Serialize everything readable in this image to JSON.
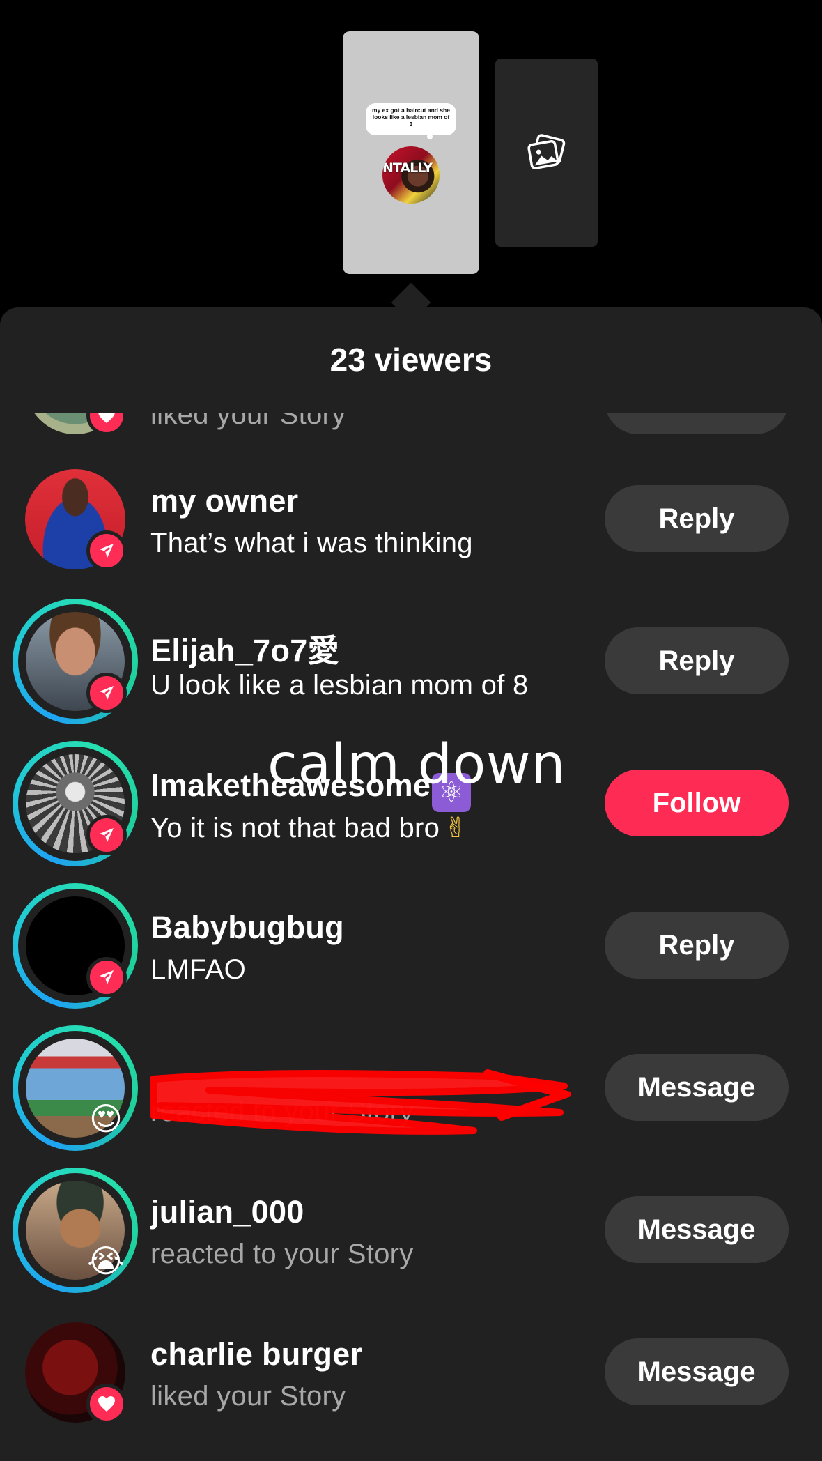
{
  "story_preview": {
    "caption": "my ex got a haircut and she looks like a lesbian mom of 3",
    "thumb_overlay": "NTALLY"
  },
  "sheet": {
    "title": "23 viewers"
  },
  "overlay_caption": "calm down",
  "viewers": [
    {
      "name": "",
      "activity": "liked your Story",
      "badge": "heart-icon",
      "action": ""
    },
    {
      "name": "my owner",
      "activity": "That’s what i was thinking",
      "badge": "send-icon",
      "action": "Reply"
    },
    {
      "name": "Elijah_7o7愛",
      "activity": "U look like a lesbian mom of 8",
      "badge": "send-icon",
      "action": "Reply"
    },
    {
      "name": "Imaketheawesome",
      "name_suffix": "⚛",
      "activity": "Yo it is not that bad bro",
      "activity_suffix": "✌",
      "badge": "send-icon",
      "action": "Follow"
    },
    {
      "name": "Babybugbug",
      "activity": "LMFAO",
      "badge": "send-icon",
      "action": "Reply"
    },
    {
      "name": "",
      "activity": "reacted to your Story",
      "badge": "😍",
      "action": "Message"
    },
    {
      "name": "julian_000",
      "activity": "reacted to your Story",
      "badge": "😭",
      "action": "Message"
    },
    {
      "name": "charlie burger",
      "activity": "liked your Story",
      "badge": "heart-icon",
      "action": "Message"
    }
  ],
  "colors": {
    "background": "#000000",
    "sheet": "#212121",
    "button": "#3a3a3a",
    "accent": "#fe2c55",
    "muted_text": "#a8a8a8",
    "ring_start": "#1fa3f3",
    "ring_end": "#27e0b0",
    "redaction": "#ff0000"
  }
}
